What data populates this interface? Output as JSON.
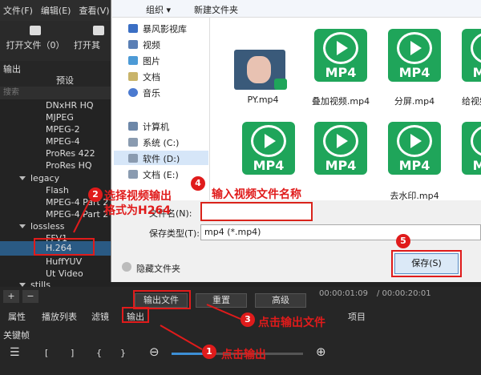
{
  "app": {
    "menus": [
      "文件(F)",
      "编辑(E)",
      "查看(V)"
    ],
    "toolbar": {
      "open_file": "打开文件（0）",
      "open_other": "打开其"
    },
    "panel_title": "输出",
    "panel_header": "预设",
    "search_placeholder": "搜索",
    "presets_top": [
      "DNxHR HQ",
      "MJPEG",
      "MPEG-2",
      "MPEG-4",
      "ProRes 422",
      "ProRes HQ"
    ],
    "group_legacy": "legacy",
    "legacy_items": [
      "Flash",
      "MPEG-4 Part 2",
      "MPEG-4 Part 2"
    ],
    "group_lossless": "lossless",
    "lossless_items": [
      "FFV1",
      "H.264",
      "HuffYUV",
      "Ut Video"
    ],
    "group_stills": "stills",
    "buttons": {
      "output_file": "输出文件",
      "reset": "重置",
      "advanced": "高级"
    },
    "tabs": [
      "属性",
      "播放列表",
      "滤镜",
      "输出",
      "项目"
    ],
    "keyframes": "关键帧",
    "timecode_current": "00:00:01:09",
    "timecode_total": "/ 00:00:20:01"
  },
  "dialog": {
    "toolbar": {
      "organize": "组织 ▾",
      "new_folder": "新建文件夹"
    },
    "nav": [
      "暴风影视库",
      "视频",
      "图片",
      "文档",
      "音乐",
      "计算机",
      "系统 (C:)",
      "软件 (D:)",
      "文档 (E:)"
    ],
    "files": [
      "PY.mp4",
      "叠加视频.mp4",
      "分屏.mp4",
      "给视频添加水",
      "",
      "",
      "",
      "",
      "去水印.mp4",
      ""
    ],
    "tile_label": "MP4",
    "filename_label": "文件名(N):",
    "filetype_label": "保存类型(T):",
    "filetype_value": "mp4 (*.mp4)",
    "hide_folders": "隐藏文件夹",
    "save": "保存(S)"
  },
  "annotations": {
    "step1": "点击输出",
    "step2_line1": "选择视频输出",
    "step2_line2": "格式为H264",
    "step3": "点击输出文件",
    "step4": "输入视频文件名称",
    "nums": [
      "1",
      "2",
      "3",
      "4",
      "5"
    ]
  }
}
